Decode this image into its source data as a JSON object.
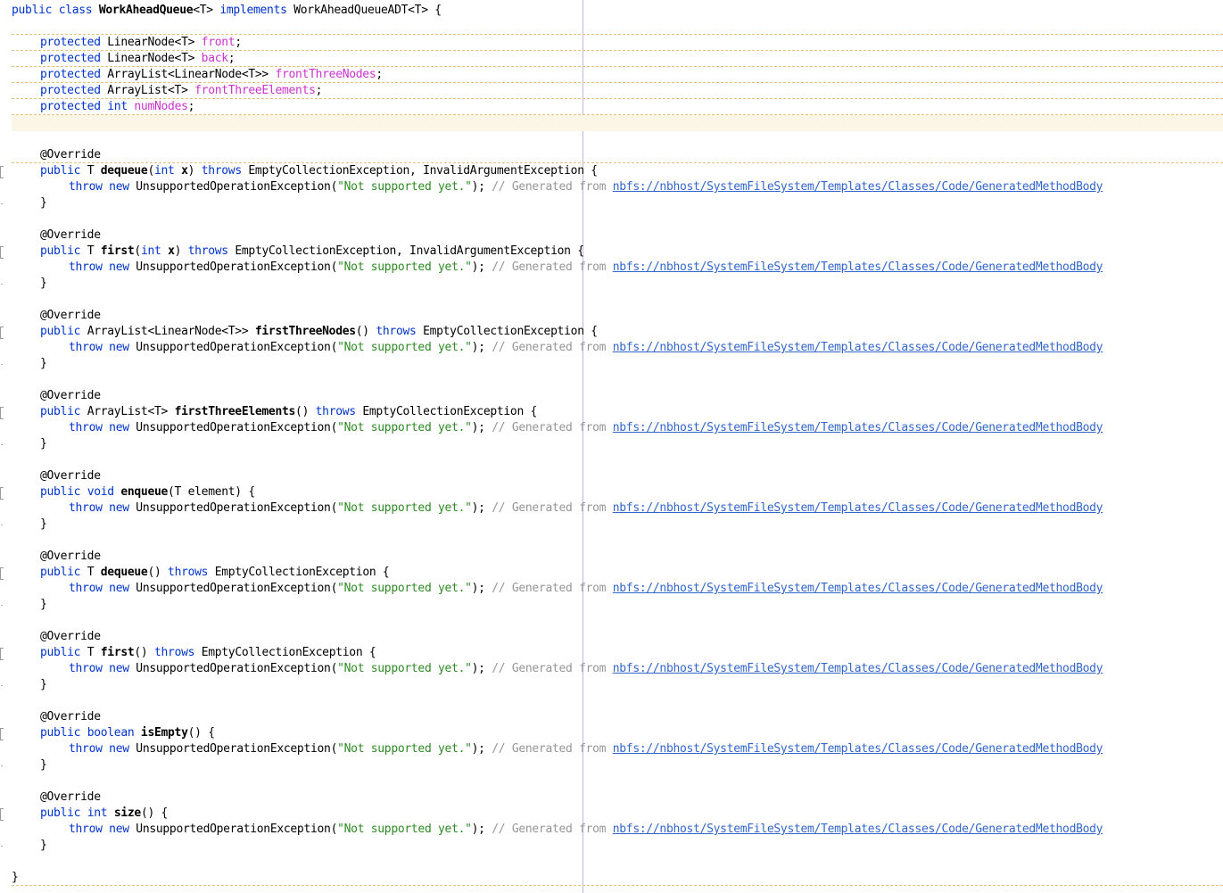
{
  "editor": {
    "class_decl": {
      "kw_public": "public",
      "kw_class": "class",
      "class_name": "WorkAheadQueue",
      "type_param": "<T>",
      "kw_implements": "implements",
      "interface": "WorkAheadQueueADT<T>",
      "brace": "{"
    },
    "fields": [
      {
        "modifier": "protected",
        "type": "LinearNode<T>",
        "type_is_keyword": false,
        "name": "front"
      },
      {
        "modifier": "protected",
        "type": "LinearNode<T>",
        "type_is_keyword": false,
        "name": "back"
      },
      {
        "modifier": "protected",
        "type": "ArrayList<LinearNode<T>>",
        "type_is_keyword": false,
        "name": "frontThreeNodes"
      },
      {
        "modifier": "protected",
        "type": "ArrayList<T>",
        "type_is_keyword": false,
        "name": "frontThreeElements"
      },
      {
        "modifier": "protected",
        "type": "int",
        "type_is_keyword": true,
        "name": "numNodes"
      }
    ],
    "annotation": "@Override",
    "throw_keyword": "throw",
    "new_keyword": "new",
    "exception_class": "UnsupportedOperationException",
    "exception_message": "\"Not supported yet.\"",
    "comment_prefix": "// Generated from",
    "comment_link": "nbfs://nbhost/SystemFileSystem/Templates/Classes/Code/GeneratedMethodBody",
    "methods": [
      {
        "kw_public": "public",
        "ret_type": "T",
        "ret_is_keyword": false,
        "name": "dequeue",
        "params_before": "(",
        "param_type": "int",
        "param_name": "x",
        "params_after": ")",
        "kw_throws": "throws",
        "throws_list": "EmptyCollectionException, InvalidArgumentException",
        "brace": "{"
      },
      {
        "kw_public": "public",
        "ret_type": "T",
        "ret_is_keyword": false,
        "name": "first",
        "params_before": "(",
        "param_type": "int",
        "param_name": "x",
        "params_after": ")",
        "kw_throws": "throws",
        "throws_list": "EmptyCollectionException, InvalidArgumentException",
        "brace": "{"
      },
      {
        "kw_public": "public",
        "ret_type": "ArrayList<LinearNode<T>>",
        "ret_is_keyword": false,
        "name": "firstThreeNodes",
        "params_before": "()",
        "param_type": "",
        "param_name": "",
        "params_after": "",
        "kw_throws": "throws",
        "throws_list": "EmptyCollectionException",
        "brace": "{"
      },
      {
        "kw_public": "public",
        "ret_type": "ArrayList<T>",
        "ret_is_keyword": false,
        "name": "firstThreeElements",
        "params_before": "()",
        "param_type": "",
        "param_name": "",
        "params_after": "",
        "kw_throws": "throws",
        "throws_list": "EmptyCollectionException",
        "brace": "{"
      },
      {
        "kw_public": "public",
        "ret_type": "void",
        "ret_is_keyword": true,
        "name": "enqueue",
        "params_before": "(T element)",
        "param_type": "",
        "param_name": "",
        "params_after": "",
        "kw_throws": "",
        "throws_list": "",
        "brace": "{"
      },
      {
        "kw_public": "public",
        "ret_type": "T",
        "ret_is_keyword": false,
        "name": "dequeue",
        "params_before": "()",
        "param_type": "",
        "param_name": "",
        "params_after": "",
        "kw_throws": "throws",
        "throws_list": "EmptyCollectionException",
        "brace": "{"
      },
      {
        "kw_public": "public",
        "ret_type": "T",
        "ret_is_keyword": false,
        "name": "first",
        "params_before": "()",
        "param_type": "",
        "param_name": "",
        "params_after": "",
        "kw_throws": "throws",
        "throws_list": "EmptyCollectionException",
        "brace": "{"
      },
      {
        "kw_public": "public",
        "ret_type": "boolean",
        "ret_is_keyword": true,
        "name": "isEmpty",
        "params_before": "()",
        "param_type": "",
        "param_name": "",
        "params_after": "",
        "kw_throws": "",
        "throws_list": "",
        "brace": "{"
      },
      {
        "kw_public": "public",
        "ret_type": "int",
        "ret_is_keyword": true,
        "name": "size",
        "params_before": "()",
        "param_type": "",
        "param_name": "",
        "params_after": "",
        "kw_throws": "",
        "throws_list": "",
        "brace": "{"
      }
    ],
    "closing_brace": "}",
    "colors": {
      "keyword": "#0033cc",
      "field": "#cc33cc",
      "string": "#2e8b24",
      "comment": "#969696",
      "link": "#3366cc",
      "current_line": "#fbf6e6",
      "margin_line": "#c8b4e6"
    }
  }
}
